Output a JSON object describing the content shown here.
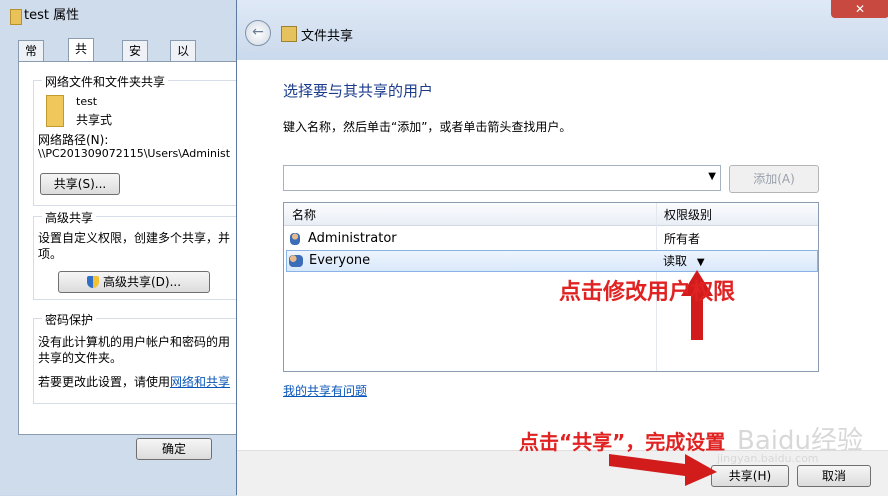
{
  "props_window": {
    "title": "test 属性",
    "tabs": [
      "常规",
      "共享",
      "安全",
      "以前的版本"
    ],
    "network_sharing": {
      "section_title": "网络文件和文件夹共享",
      "folder_name": "test",
      "folder_status": "共享式",
      "network_path_label": "网络路径(N):",
      "network_path_value": "\\\\PC20130907​2115\\Users\\Administ",
      "share_button": "共享(S)..."
    },
    "advanced_sharing": {
      "section_title": "高级共享",
      "description_line1": "设置自定义权限，创建多个共享，并",
      "description_line2": "项。",
      "button": "高级共享(D)..."
    },
    "password_protect": {
      "section_title": "密码保护",
      "text_line1": "没有此计算机的用户帐户和密码的用",
      "text_line2": "共享的文件夹。",
      "text_line3_prefix": "若要更改此设置，请使用",
      "text_line3_link": "网络和共享"
    },
    "ok_button": "确定"
  },
  "wizard": {
    "title": "文件共享",
    "heading": "选择要与其共享的用户",
    "instruction": "键入名称，然后单击“添加”，或者单击箭头查找用户。",
    "add_button": "添加(A)",
    "columns": [
      "名称",
      "权限级别"
    ],
    "rows": [
      {
        "name": "Administrator",
        "permission": "所有者"
      },
      {
        "name": "Everyone",
        "permission": "读取"
      }
    ],
    "help_link": "我的共享有问题",
    "share_button": "共享(H)",
    "cancel_button": "取消"
  },
  "annotations": {
    "modify_permission": "点击修改用户权限",
    "click_share": "点击“共享”，完成设置"
  },
  "watermark": {
    "main": "Baidu经验",
    "sub": "jingyan.baidu.com"
  }
}
